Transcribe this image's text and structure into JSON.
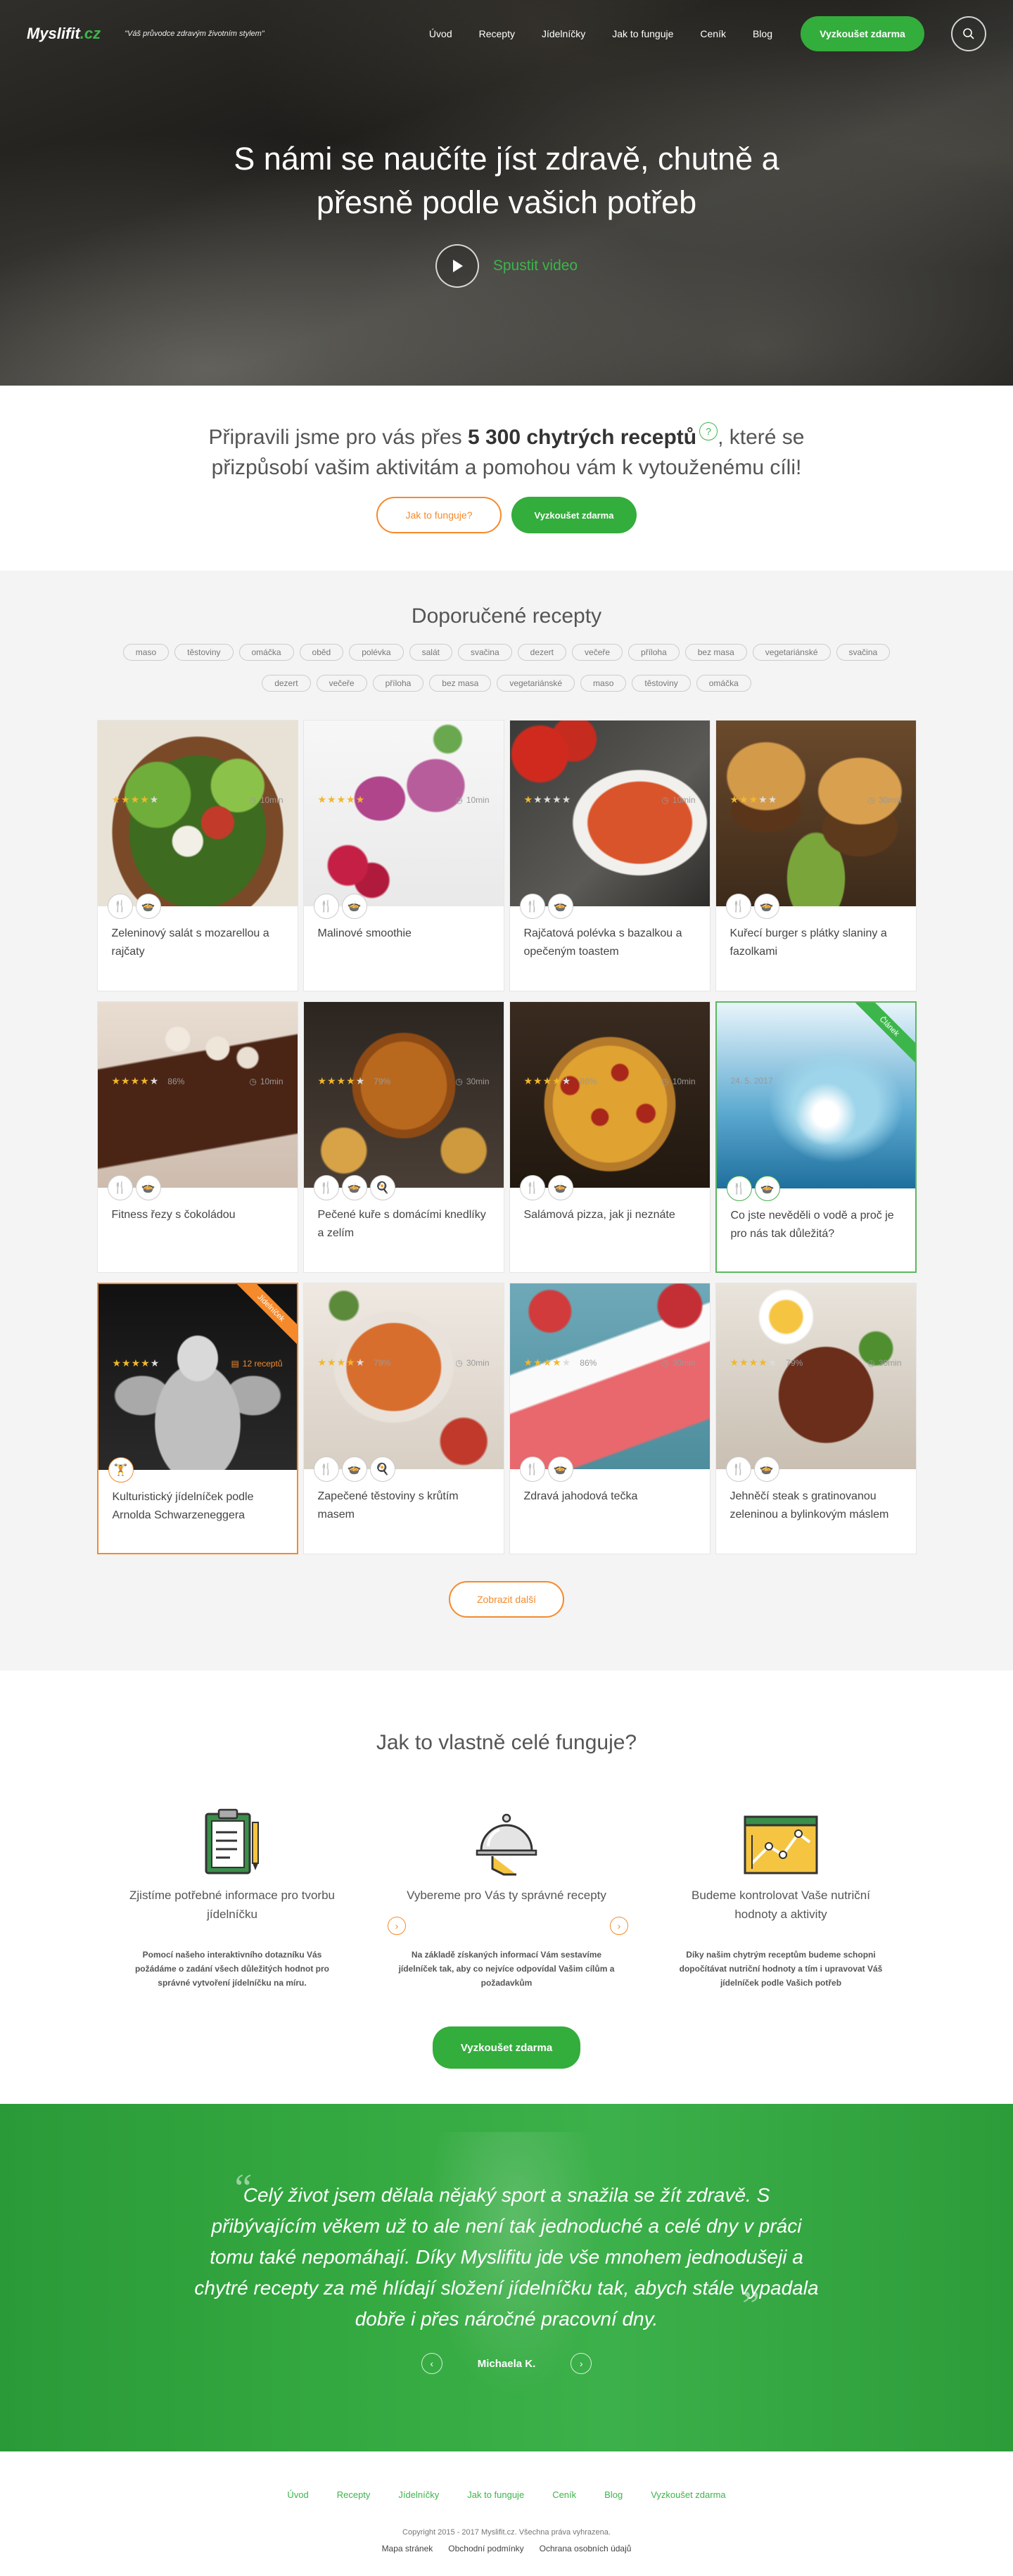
{
  "header": {
    "logo_main": "Myslifit",
    "logo_tld": ".cz",
    "tagline": "\"Váš průvodce zdravým životním stylem\"",
    "nav": [
      "Úvod",
      "Recepty",
      "Jídelníčky",
      "Jak to funguje",
      "Ceník",
      "Blog"
    ],
    "cta": "Vyzkoušet zdarma"
  },
  "hero": {
    "title": "S námi se naučíte jíst zdravě, chutně a přesně podle vašich potřeb",
    "video_label": "Spustit video"
  },
  "intro": {
    "text_before": "Připravili jsme pro vás přes ",
    "text_bold": "5 300 chytrých receptů",
    "text_after": ", které se přizpůsobí vašim aktivitám a pomohou vám k vytouženému cíli!",
    "help_mark": "?",
    "btn_how": "Jak to funguje?",
    "btn_try": "Vyzkoušet zdarma"
  },
  "recipes": {
    "title": "Doporučené recepty",
    "tags_row1": [
      "maso",
      "těstoviny",
      "omáčka",
      "oběd",
      "polévka",
      "salát",
      "svačina",
      "dezert",
      "večeře",
      "příloha",
      "bez masa",
      "vegetariánské",
      "svačina"
    ],
    "tags_row2": [
      "dezert",
      "večeře",
      "příloha",
      "bez masa",
      "vegetariánské",
      "maso",
      "těstoviny",
      "omáčka"
    ],
    "cards": [
      {
        "title": "Zeleninový salát s mozarellou a rajčaty",
        "rating": 4,
        "pct": "",
        "time": "10min"
      },
      {
        "title": "Malinové smoothie",
        "rating": 5,
        "pct": "",
        "time": "10min"
      },
      {
        "title": "Rajčatová polévka s bazalkou a opečeným toastem",
        "rating": 1,
        "pct": "",
        "time": "10min"
      },
      {
        "title": "Kuřecí burger s plátky slaniny a fazolkami",
        "rating": 3,
        "pct": "",
        "time": "30min"
      },
      {
        "title": "Fitness řezy s čokoládou",
        "rating": 4,
        "pct": "86%",
        "time": "10min"
      },
      {
        "title": "Pečené kuře s domácími knedlíky a zelím",
        "rating": 4,
        "pct": "79%",
        "time": "30min"
      },
      {
        "title": "Salámová pizza, jak ji neznáte",
        "rating": 4,
        "pct": "86%",
        "time": "10min"
      },
      {
        "title": "Co jste nevěděli o vodě a proč je pro nás tak důležitá?",
        "date": "24. 5. 2017",
        "ribbon": "Článek"
      },
      {
        "title": "Kulturistický jídelníček podle Arnolda Schwarzeneggera",
        "rating": 4,
        "recipes": "12 receptů",
        "ribbon": "Jídelníček"
      },
      {
        "title": "Zapečené těstoviny s krůtím masem",
        "rating": 4,
        "pct": "79%",
        "time": "30min"
      },
      {
        "title": "Zdravá jahodová tečka",
        "rating": 4,
        "pct": "86%",
        "time": "30min"
      },
      {
        "title": "Jehněčí steak s gratinovanou zeleninou a bylinkovým máslem",
        "rating": 4,
        "pct": "79%",
        "time": "30min"
      }
    ],
    "more": "Zobrazit další"
  },
  "how": {
    "title": "Jak to vlastně celé funguje?",
    "steps": [
      {
        "title": "Zjistíme potřebné informace pro tvorbu jídelníčku",
        "text": "Pomocí našeho interaktivního dotazníku Vás požádáme o zadání všech důležitých hodnot pro správné vytvoření jídelníčku na míru."
      },
      {
        "title": "Vybereme pro Vás ty správné recepty",
        "text": "Na základě získaných informací Vám sestavíme jídelníček tak, aby co nejvíce odpovídal Vašim cílům a požadavkům"
      },
      {
        "title": "Budeme kontrolovat Vaše nutriční hodnoty a aktivity",
        "text": "Díky našim chytrým receptům budeme schopni dopočítávat nutriční hodnoty a tím i upravovat Váš jídelníček podle Vašich potřeb"
      }
    ],
    "cta": "Vyzkoušet zdarma"
  },
  "testimonial": {
    "quote": "Celý život jsem dělala nějaký sport a snažila se žít zdravě. S přibývajícím věkem už to ale není tak jednoduché a celé dny v práci tomu také nepomáhají. Díky Myslifitu jde vše mnohem jednodušeji a chytré recepty za mě hlídají složení jídelníčku tak, abych stále vypadala dobře i přes náročné pracovní dny.",
    "author": "Michaela K."
  },
  "footer": {
    "menu": [
      "Úvod",
      "Recepty",
      "Jídelníčky",
      "Jak to funguje",
      "Ceník",
      "Blog",
      "Vyzkoušet zdarma"
    ],
    "copyright": "Copyright 2015 - 2017 Myslifit.cz. Všechna práva vyhrazena.",
    "legal": [
      "Mapa stránek",
      "Obchodní podmínky",
      "Ochrana osobních údajů"
    ]
  },
  "colors": {
    "brand_green": "#33ad3c",
    "accent_orange": "#f58a2c",
    "star": "#f1b72c"
  }
}
